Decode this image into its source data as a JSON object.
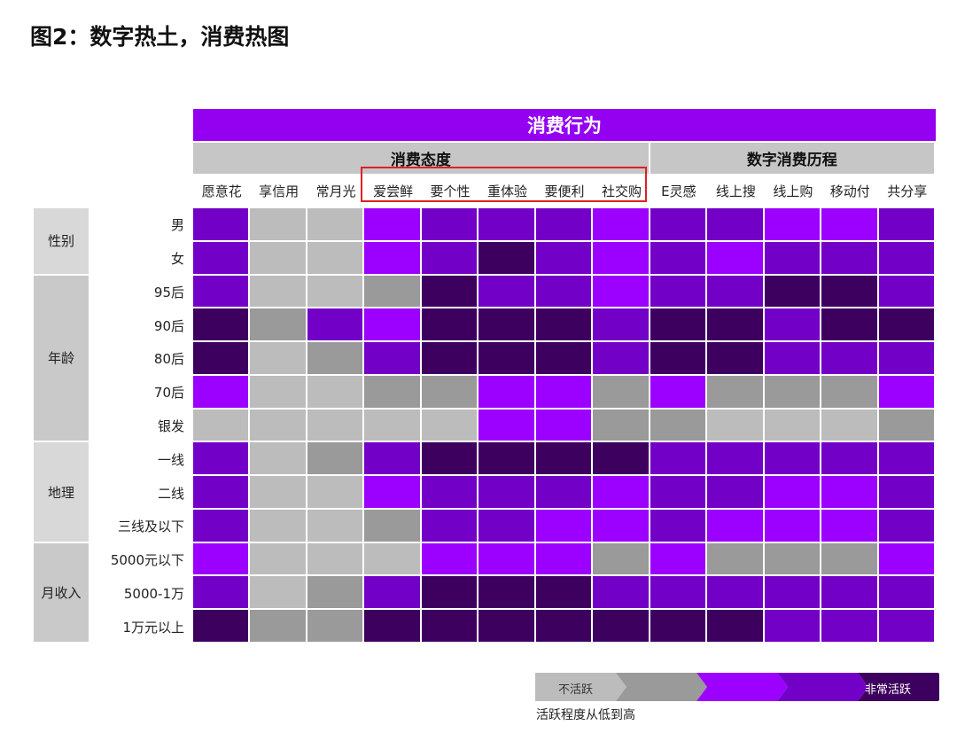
{
  "title": "图2：数字热土，消费热图",
  "colors": {
    "accent": "#9400f0",
    "subheader": "#c6c6c6",
    "highlight_border": "#e02020",
    "levels": [
      "#bcbcbc",
      "#9a9a9a",
      "#9c00ff",
      "#7300c7",
      "#3e005f"
    ]
  },
  "chart_data": {
    "type": "heatmap",
    "title": "消费行为",
    "column_groups": [
      {
        "label": "消费态度",
        "span": 8
      },
      {
        "label": "数字消费历程",
        "span": 5
      }
    ],
    "columns": [
      "愿意花",
      "享信用",
      "常月光",
      "爱尝鲜",
      "要个性",
      "重体验",
      "要便利",
      "社交购",
      "E灵感",
      "线上搜",
      "线上购",
      "移动付",
      "共分享"
    ],
    "row_groups": [
      {
        "label": "性别",
        "span": 2
      },
      {
        "label": "年龄",
        "span": 5
      },
      {
        "label": "地理",
        "span": 3
      },
      {
        "label": "月收入",
        "span": 3
      }
    ],
    "rows": [
      "男",
      "女",
      "95后",
      "90后",
      "80后",
      "70后",
      "银发",
      "一线",
      "二线",
      "三线及以下",
      "5000元以下",
      "5000-1万",
      "1万元以上"
    ],
    "scale": "activity level 1 (不活跃) to 5 (非常活跃)",
    "values": [
      [
        4,
        1,
        1,
        3,
        4,
        4,
        4,
        3,
        4,
        4,
        3,
        3,
        4
      ],
      [
        4,
        1,
        1,
        3,
        4,
        5,
        4,
        3,
        4,
        3,
        4,
        4,
        4
      ],
      [
        4,
        1,
        1,
        2,
        5,
        4,
        4,
        3,
        4,
        4,
        5,
        5,
        4
      ],
      [
        5,
        2,
        4,
        3,
        5,
        5,
        5,
        4,
        5,
        5,
        4,
        5,
        5
      ],
      [
        5,
        1,
        2,
        4,
        5,
        5,
        5,
        4,
        5,
        5,
        4,
        4,
        4
      ],
      [
        3,
        1,
        1,
        2,
        2,
        3,
        3,
        2,
        3,
        2,
        2,
        2,
        3
      ],
      [
        1,
        1,
        1,
        1,
        1,
        3,
        3,
        2,
        2,
        1,
        1,
        1,
        2
      ],
      [
        4,
        1,
        2,
        4,
        5,
        5,
        5,
        5,
        4,
        4,
        4,
        4,
        4
      ],
      [
        4,
        1,
        1,
        3,
        4,
        4,
        4,
        3,
        4,
        4,
        3,
        3,
        4
      ],
      [
        4,
        1,
        1,
        2,
        4,
        4,
        3,
        3,
        4,
        3,
        3,
        3,
        4
      ],
      [
        3,
        1,
        1,
        1,
        3,
        3,
        3,
        2,
        3,
        2,
        2,
        2,
        3
      ],
      [
        4,
        1,
        2,
        4,
        5,
        5,
        5,
        4,
        4,
        4,
        4,
        4,
        4
      ],
      [
        5,
        2,
        2,
        5,
        5,
        5,
        5,
        5,
        5,
        5,
        4,
        4,
        4
      ]
    ],
    "highlighted_columns": [
      "爱尝鲜",
      "要个性",
      "重体验",
      "要便利",
      "社交购"
    ]
  },
  "legend": {
    "low_label": "不活跃",
    "high_label": "非常活跃",
    "caption": "活跃程度从低到高"
  }
}
